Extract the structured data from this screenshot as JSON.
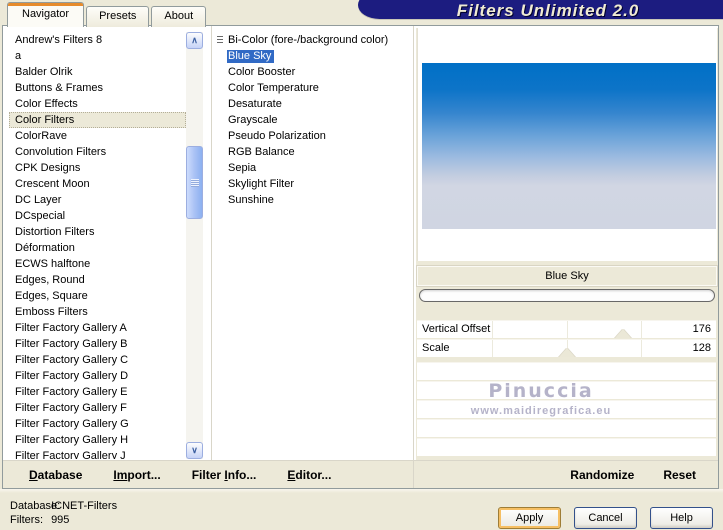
{
  "tabs": [
    {
      "label": "Navigator",
      "active": true
    },
    {
      "label": "Presets",
      "active": false
    },
    {
      "label": "About",
      "active": false
    }
  ],
  "banner": {
    "title": "Filters Unlimited 2.0"
  },
  "category_list": {
    "selected_index": 5,
    "items": [
      "Andrew's Filters 8",
      "a",
      "Balder Olrik",
      "Buttons & Frames",
      "Color Effects",
      "Color Filters",
      "ColorRave",
      "Convolution Filters",
      "CPK Designs",
      "Crescent Moon",
      "DC Layer",
      "DCspecial",
      "Distortion Filters",
      "Déformation",
      "ECWS halftone",
      "Edges, Round",
      "Edges, Square",
      "Emboss Filters",
      "Filter Factory Gallery A",
      "Filter Factory Gallery B",
      "Filter Factory Gallery C",
      "Filter Factory Gallery D",
      "Filter Factory Gallery E",
      "Filter Factory Gallery F",
      "Filter Factory Gallery G",
      "Filter Factory Gallery H",
      "Filter Factory Gallery J"
    ]
  },
  "filter_list": {
    "selected_index": 1,
    "items": [
      "Bi-Color (fore-/background color)",
      "Blue Sky",
      "Color Booster",
      "Color Temperature",
      "Desaturate",
      "Grayscale",
      "Pseudo Polarization",
      "RGB Balance",
      "Sepia",
      "Skylight Filter",
      "Sunshine"
    ]
  },
  "preview": {
    "caption": "Blue Sky"
  },
  "sliders": {
    "max": 256,
    "items": [
      {
        "label": "Vertical Offset",
        "value": 176
      },
      {
        "label": "Scale",
        "value": 128
      }
    ]
  },
  "watermark": {
    "line1": "Pinuccia",
    "line2": "www.maidiregrafica.eu"
  },
  "toolbar": {
    "left_items": [
      {
        "name": "database",
        "pre": "",
        "u": "D",
        "post": "atabase"
      },
      {
        "name": "import",
        "pre": "",
        "u": "Im",
        "post": "port..."
      },
      {
        "name": "filter-info",
        "pre": "Filter ",
        "u": "I",
        "post": "nfo..."
      },
      {
        "name": "editor",
        "pre": "",
        "u": "E",
        "post": "ditor..."
      }
    ],
    "right_items": [
      {
        "name": "randomize",
        "pre": "Randomize",
        "u": "",
        "post": ""
      },
      {
        "name": "reset",
        "pre": "Reset",
        "u": "",
        "post": ""
      }
    ]
  },
  "status": {
    "database_label": "Database:",
    "database_value": "ICNET-Filters",
    "filters_label": "Filters:",
    "filters_value": "995"
  },
  "action_buttons": [
    {
      "name": "apply",
      "label": "Apply",
      "default": true
    },
    {
      "name": "cancel",
      "label": "Cancel",
      "default": false
    },
    {
      "name": "help",
      "label": "Help",
      "default": false
    }
  ],
  "icons": {
    "scroll_up_glyph": "∧",
    "scroll_down_glyph": "∨"
  },
  "colors": {
    "dialog_beige": "#ece9d8",
    "selection_blue": "#316ac5",
    "banner_navy": "#1c1c80",
    "active_tab_accent": "#e68b2c",
    "preview_sky_top": "#0070c6",
    "preview_sky_bottom": "#d0d5e2"
  }
}
